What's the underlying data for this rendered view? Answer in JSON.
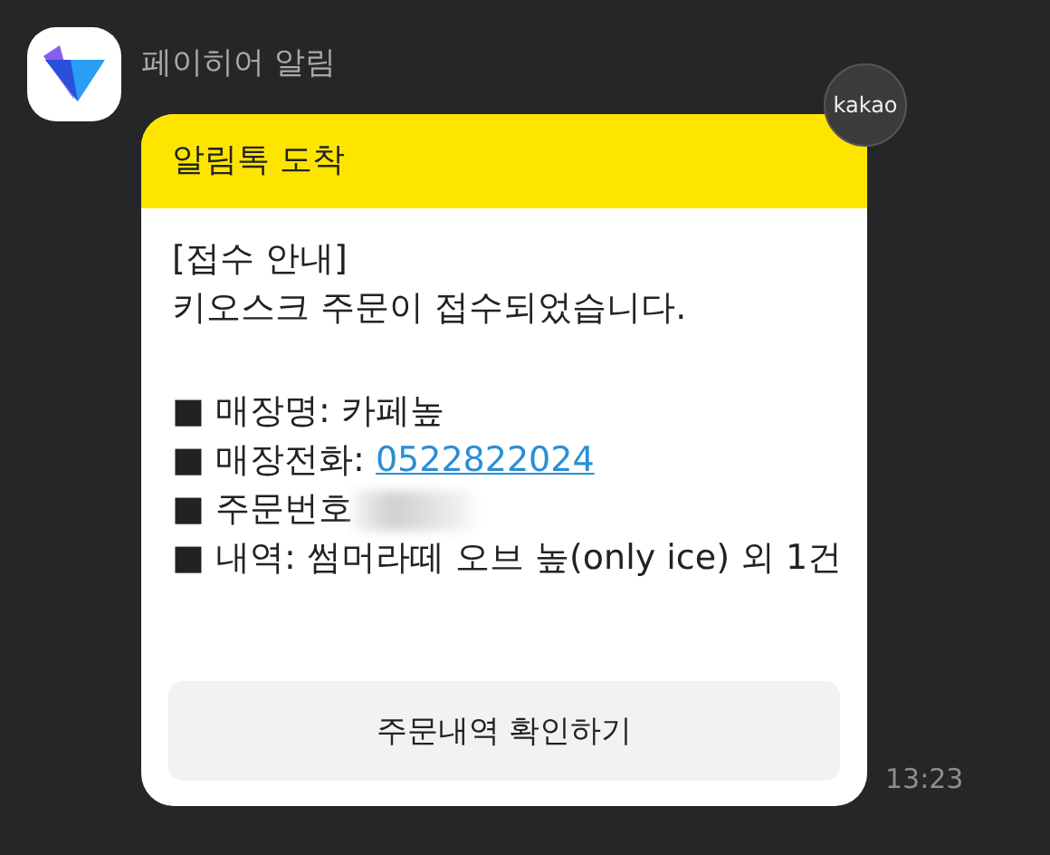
{
  "sender": {
    "name": "페이히어 알림"
  },
  "badge": {
    "label": "kakao"
  },
  "message": {
    "header": "알림톡 도착",
    "intro": [
      "[접수 안내]",
      "키오스크 주문이 접수되었습니다."
    ],
    "details": [
      {
        "kind": "text",
        "text": "■ 매장명: 카페높"
      },
      {
        "kind": "link",
        "text": "■ 매장전화: ",
        "link": "0522822024"
      },
      {
        "kind": "redacted",
        "text": "■ 주문번호"
      },
      {
        "kind": "text",
        "text": "■ 내역: 썸머라떼 오브 높(only ice) 외 1건"
      }
    ],
    "button": "주문내역 확인하기"
  },
  "time": "13:23"
}
